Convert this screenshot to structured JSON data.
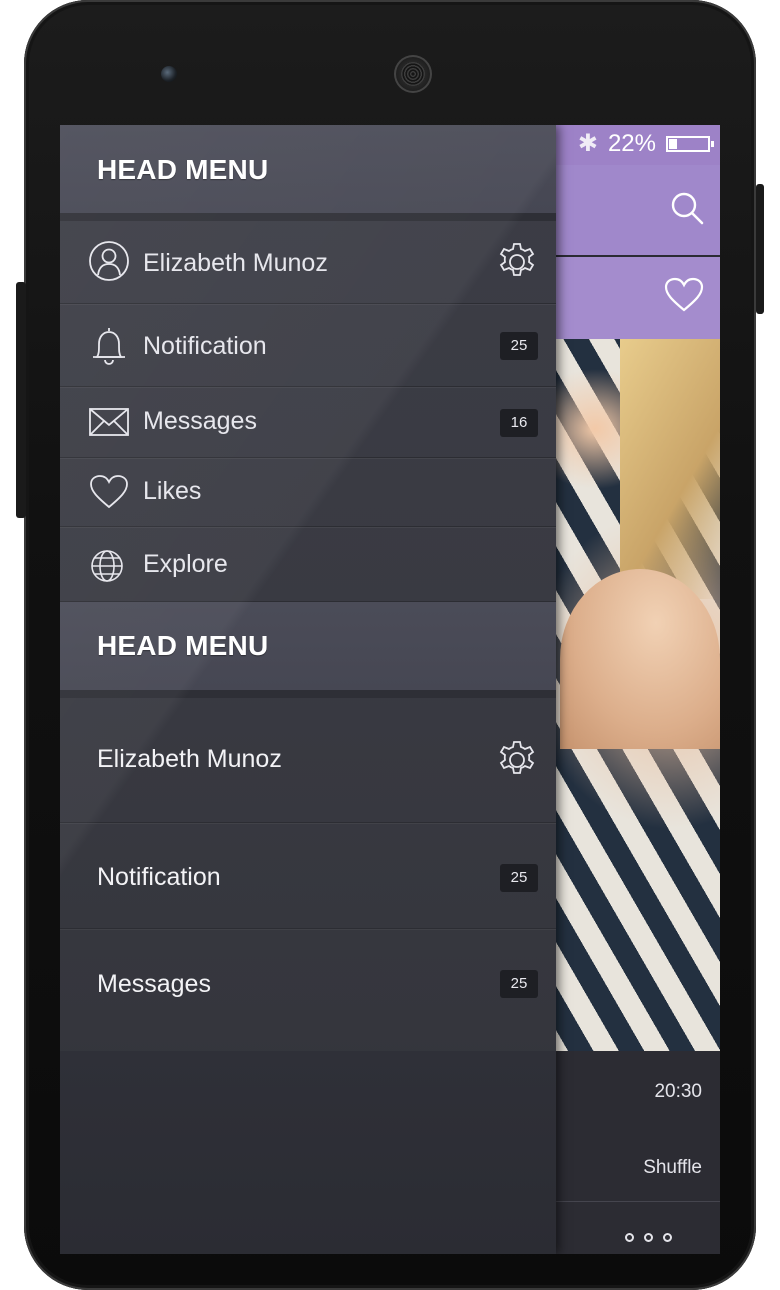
{
  "status_bar": {
    "battery_text": "22%",
    "battery_level": 0.22,
    "bluetooth_icon": "bluetooth-icon"
  },
  "app": {
    "search_icon": "search-icon",
    "heart_icon": "heart-icon",
    "time": "20:30",
    "shuffle": "Shuffle"
  },
  "drawer": {
    "section1": {
      "title": "HEAD MENU",
      "items": [
        {
          "label": "Elizabeth Munoz",
          "icon": "user-icon",
          "trailing": "gear-icon"
        },
        {
          "label": "Notification",
          "icon": "bell-icon",
          "badge": "25"
        },
        {
          "label": "Messages",
          "icon": "envelope-icon",
          "badge": "16"
        },
        {
          "label": "Likes",
          "icon": "heart-icon"
        },
        {
          "label": "Explore",
          "icon": "globe-icon"
        }
      ]
    },
    "section2": {
      "title": "HEAD MENU",
      "items": [
        {
          "label": "Elizabeth Munoz",
          "trailing": "gear-icon"
        },
        {
          "label": "Notification",
          "badge": "25"
        },
        {
          "label": "Messages",
          "badge": "25"
        }
      ]
    }
  },
  "colors": {
    "accent": "#9d82c7",
    "drawer_bg": "#3a3b43",
    "badge_bg": "#1e1f24"
  }
}
